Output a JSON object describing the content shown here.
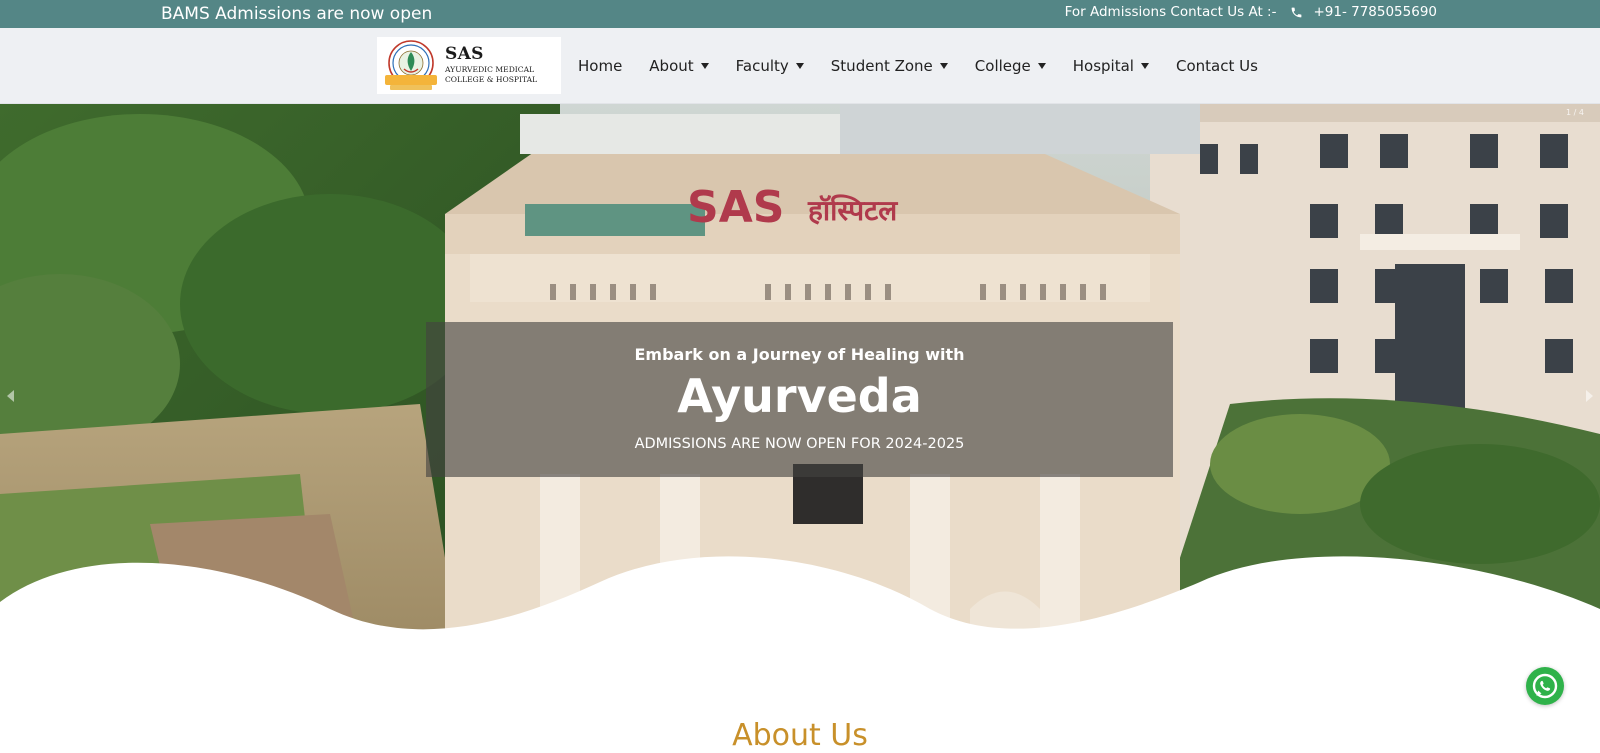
{
  "topbar": {
    "announcement": "BAMS Admissions are now open",
    "contact_label": "For Admissions Contact Us At :-",
    "phone_icon": "phone-icon",
    "phone": "+91- 7785055690"
  },
  "header": {
    "logo": {
      "brand": "SAS",
      "subtitle_line1": "AYURVEDIC MEDICAL",
      "subtitle_line2": "COLLEGE & HOSPITAL",
      "emblem_icon": "college-emblem-icon"
    },
    "nav": [
      {
        "label": "Home",
        "dropdown": false
      },
      {
        "label": "About",
        "dropdown": true
      },
      {
        "label": "Faculty",
        "dropdown": true
      },
      {
        "label": "Student Zone",
        "dropdown": true
      },
      {
        "label": "College",
        "dropdown": true
      },
      {
        "label": "Hospital",
        "dropdown": true
      },
      {
        "label": "Contact Us",
        "dropdown": false
      }
    ]
  },
  "hero": {
    "slide_counter": "1 / 4",
    "prev_icon": "chevron-left-icon",
    "next_icon": "chevron-right-icon",
    "caption": {
      "lead": "Embark on a Journey of Healing with",
      "title": "Ayurveda",
      "subtitle": "ADMISSIONS ARE NOW OPEN FOR 2024-2025"
    },
    "building_sign": "SAS हॉस्पिटल"
  },
  "about": {
    "heading": "About Us"
  },
  "floating": {
    "whatsapp_icon": "whatsapp-icon"
  },
  "colors": {
    "topbar": "#548686",
    "header_bg": "#eef0f3",
    "accent_heading": "#c8902a",
    "whatsapp": "#2fb24a"
  }
}
